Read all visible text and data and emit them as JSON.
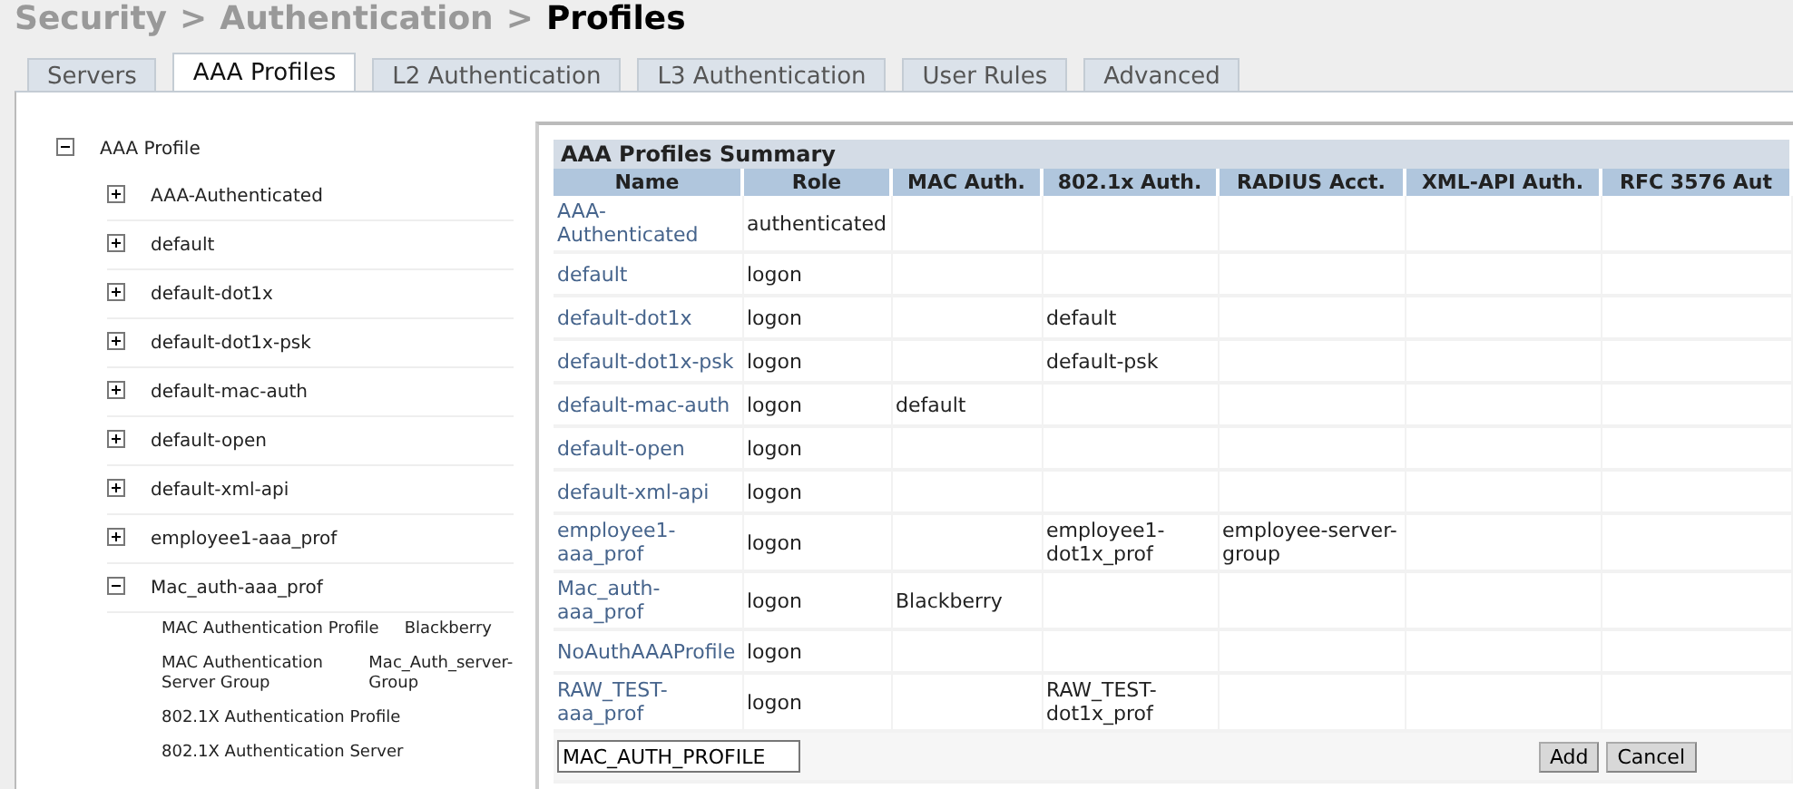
{
  "breadcrumb": {
    "items": [
      {
        "label": "Security",
        "current": false
      },
      {
        "label": "Authentication",
        "current": false
      },
      {
        "label": "Profiles",
        "current": true
      }
    ],
    "separator": ">"
  },
  "tabs": [
    {
      "label": "Servers",
      "selected": false
    },
    {
      "label": "AAA Profiles",
      "selected": true
    },
    {
      "label": "L2 Authentication",
      "selected": false
    },
    {
      "label": "L3 Authentication",
      "selected": false
    },
    {
      "label": "User Rules",
      "selected": false
    },
    {
      "label": "Advanced",
      "selected": false
    }
  ],
  "tree": {
    "label": "AAA Profile",
    "expanded": true,
    "children": [
      {
        "kind": "node",
        "label": "AAA-Authenticated",
        "expanded": false
      },
      {
        "kind": "node",
        "label": "default",
        "expanded": false
      },
      {
        "kind": "node",
        "label": "default-dot1x",
        "expanded": false
      },
      {
        "kind": "node",
        "label": "default-dot1x-psk",
        "expanded": false
      },
      {
        "kind": "node",
        "label": "default-mac-auth",
        "expanded": false
      },
      {
        "kind": "node",
        "label": "default-open",
        "expanded": false
      },
      {
        "kind": "node",
        "label": "default-xml-api",
        "expanded": false
      },
      {
        "kind": "node",
        "label": "employee1-aaa_prof",
        "expanded": false
      },
      {
        "kind": "node",
        "label": "Mac_auth-aaa_prof",
        "expanded": true,
        "children": [
          {
            "kind": "property",
            "label": "MAC Authentication Profile",
            "value": "Blackberry"
          },
          {
            "kind": "property",
            "label": "MAC Authentication Server Group",
            "value": "Mac_Auth_server-Group"
          },
          {
            "kind": "property",
            "label": "802.1X Authentication Profile"
          },
          {
            "kind": "property",
            "label": "802.1X Authentication Server"
          }
        ]
      }
    ]
  },
  "summary": {
    "title": "AAA Profiles Summary",
    "columns": [
      "Name",
      "Role",
      "MAC Auth.",
      "802.1x Auth.",
      "RADIUS Acct.",
      "XML-API Auth.",
      "RFC 3576 Aut"
    ],
    "rows": [
      [
        "AAA-Authenticated",
        "authenticated",
        "",
        "",
        "",
        "",
        ""
      ],
      [
        "default",
        "logon",
        "",
        "",
        "",
        "",
        ""
      ],
      [
        "default-dot1x",
        "logon",
        "",
        "default",
        "",
        "",
        ""
      ],
      [
        "default-dot1x-psk",
        "logon",
        "",
        "default-psk",
        "",
        "",
        ""
      ],
      [
        "default-mac-auth",
        "logon",
        "default",
        "",
        "",
        "",
        ""
      ],
      [
        "default-open",
        "logon",
        "",
        "",
        "",
        "",
        ""
      ],
      [
        "default-xml-api",
        "logon",
        "",
        "",
        "",
        "",
        ""
      ],
      [
        "employee1-aaa_prof",
        "logon",
        "",
        "employee1-dot1x_prof",
        "employee-server-group",
        "",
        ""
      ],
      [
        "Mac_auth-aaa_prof",
        "logon",
        "Blackberry",
        "",
        "",
        "",
        ""
      ],
      [
        "NoAuthAAAProfile",
        "logon",
        "",
        "",
        "",
        "",
        ""
      ],
      [
        "RAW_TEST-aaa_prof",
        "logon",
        "",
        "RAW_TEST-dot1x_prof",
        "",
        "",
        ""
      ]
    ],
    "new_name": "MAC_AUTH_PROFILE",
    "buttons": [
      "Add",
      "Cancel"
    ]
  }
}
